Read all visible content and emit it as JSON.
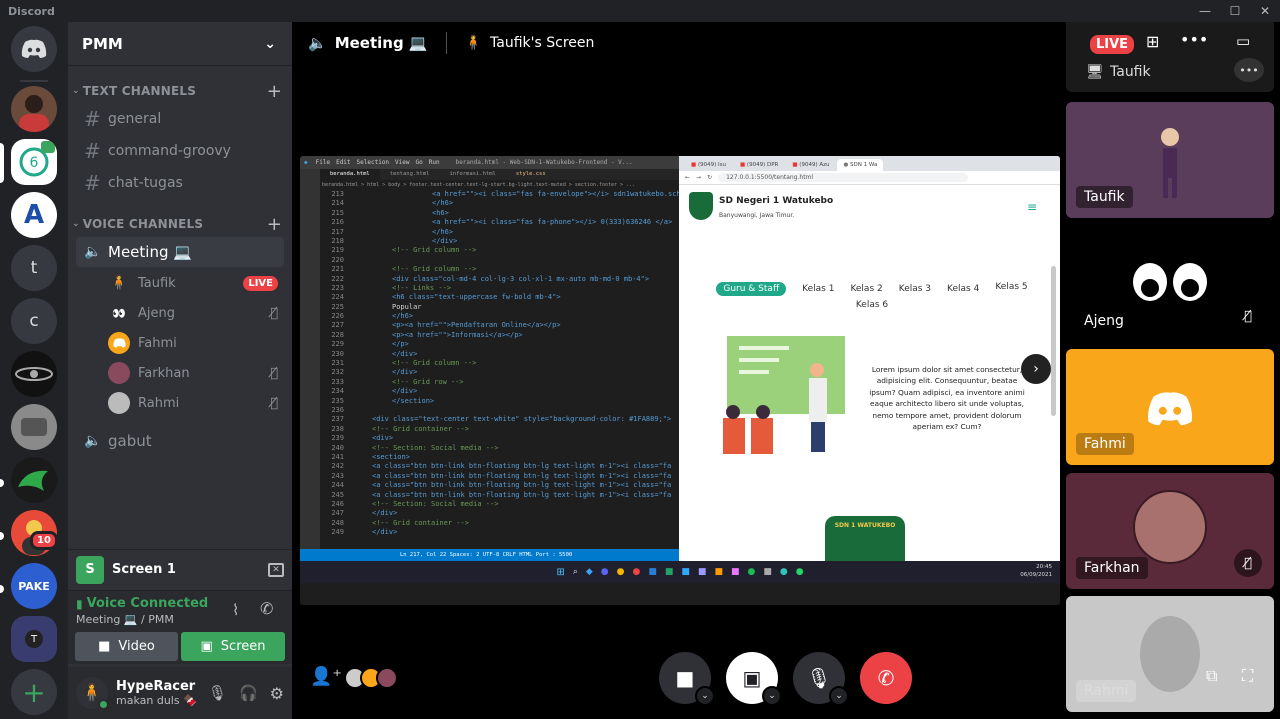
{
  "titlebar": {
    "app_name": "Discord"
  },
  "servers": [
    {
      "label": "",
      "kind": "home"
    },
    {
      "label": "",
      "kind": "avatar"
    },
    {
      "label": "",
      "kind": "selected"
    },
    {
      "label": "A",
      "kind": "letter"
    },
    {
      "label": "t",
      "kind": "letter"
    },
    {
      "label": "c",
      "kind": "letter"
    },
    {
      "label": "",
      "kind": "avatar"
    },
    {
      "label": "",
      "kind": "avatar"
    },
    {
      "label": "",
      "kind": "avatar"
    },
    {
      "label": "10",
      "kind": "badge"
    },
    {
      "label": "PAKE",
      "kind": "avatar"
    },
    {
      "label": "T",
      "kind": "folder"
    },
    {
      "label": "+",
      "kind": "add"
    }
  ],
  "server": {
    "name": "PMM"
  },
  "text_channels": {
    "label": "TEXT CHANNELS",
    "items": [
      "general",
      "command-groovy",
      "chat-tugas"
    ]
  },
  "voice_channels": {
    "label": "VOICE CHANNELS",
    "meeting": "Meeting 💻",
    "members": [
      {
        "name": "Taufik",
        "status": "LIVE"
      },
      {
        "name": "Ajeng",
        "status": "muted"
      },
      {
        "name": "Fahmi",
        "status": ""
      },
      {
        "name": "Farkhan",
        "status": "muted"
      },
      {
        "name": "Rahmi",
        "status": "muted"
      }
    ],
    "other": "gabut"
  },
  "screen_share": {
    "label": "Screen 1"
  },
  "voice": {
    "status": "Voice Connected",
    "location": "Meeting 💻 / PMM",
    "video_label": "Video",
    "screen_label": "Screen"
  },
  "user": {
    "name": "HypeRacer",
    "status": "makan duls 🍫"
  },
  "call": {
    "channel": "Meeting 💻",
    "streamer": "Taufik's Screen"
  },
  "tiles": [
    {
      "name": "Taufik",
      "live": "LIVE"
    },
    {
      "name": "Taufik"
    },
    {
      "name": "Ajeng"
    },
    {
      "name": "Fahmi"
    },
    {
      "name": "Farkhan"
    },
    {
      "name": "Rahmi"
    }
  ],
  "vscode": {
    "menu": [
      "File",
      "Edit",
      "Selection",
      "View",
      "Go",
      "Run"
    ],
    "title": "beranda.html - Web-SDN-1-Watukebo-Frontend - V...",
    "tabs": [
      "beranda.html",
      "tentang.html",
      "informasi.html",
      "style.css"
    ],
    "breadcrumb": "beranda.html > html > body > footer.text-center.text-lg-start.bg-light.text-muted > section.footer > ...",
    "line_start": 213,
    "lines": [
      "<a href=\"\"><i class=\"fas fa-envelope\"></i>  sdn1watukebo.sch.id</a>",
      "</h6>",
      "<h6>",
      "<a href=\"\"><i class=\"fas fa-phone\"></i>  0(333)636246  </a>",
      "</h6>",
      "</div>",
      "<!-- Grid column -->",
      "",
      "<!-- Grid column -->",
      "<div class=\"col-md-4 col-lg-3 col-xl-1 mx-auto mb-md-0 mb-4\">",
      "<!-- Links -->",
      "<h6 class=\"text-uppercase fw-bold mb-4\">",
      "Popular",
      "</h6>",
      "<p><a href=\"\">Pendaftaran Online</a></p>",
      "<p><a href=\"\">Informasi</a></p>",
      "</p>",
      "</div>",
      "<!-- Grid column -->",
      "</div>",
      "<!-- Grid row -->",
      "</div>",
      "</section>",
      "",
      "<div class=\"text-center text-white\" style=\"background-color: #1FA889;\">",
      "<!-- Grid container -->",
      "<div>",
      "<!-- Section: Social media -->",
      "<section>",
      "<a class=\"btn btn-link btn-floating btn-lg text-light m-1\"><i class=\"fa",
      "<a class=\"btn btn-link btn-floating btn-lg text-light m-1\"><i class=\"fa",
      "<a class=\"btn btn-link btn-floating btn-lg text-light m-1\"><i class=\"fa",
      "<a class=\"btn btn-link btn-floating btn-lg text-light m-1\"><i class=\"fa",
      "<!-- Section: Social media -->",
      "</div>",
      "<!-- Grid container -->",
      "</div>"
    ],
    "statusbar": "Ln 217, Col 22   Spaces: 2   UTF-8   CRLF   HTML   Port : 5500"
  },
  "browser": {
    "tabs": [
      "(9049) Isu",
      "(9049) DPR",
      "(9049) Azu",
      "SDN 1 Wa"
    ],
    "url": "127.0.0.1:5500/tentang.html",
    "site_title": "SD Negeri 1 Watukebo",
    "site_sub": "Banyuwangi, Jawa Timur.",
    "pills": [
      "Guru & Staff",
      "Kelas 1",
      "Kelas 2",
      "Kelas 3",
      "Kelas 4",
      "Kelas 5",
      "Kelas 6"
    ],
    "lorem": "Lorem ipsum dolor sit amet consectetur, adipisicing elit. Consequuntur, beatae ipsum? Quam adipisci, ea inventore animi eaque architecto libero sit unde voluptas, nemo tempore amet, provident dolorum aperiam ex? Cum?",
    "badge_text": "SDN 1 WATUKEBO"
  },
  "taskbar": {
    "time": "20:45",
    "date": "06/09/2021"
  },
  "colors": {
    "accent": "#5865f2",
    "green": "#3ba55d",
    "red": "#ed4245",
    "teal": "#1fa889"
  }
}
